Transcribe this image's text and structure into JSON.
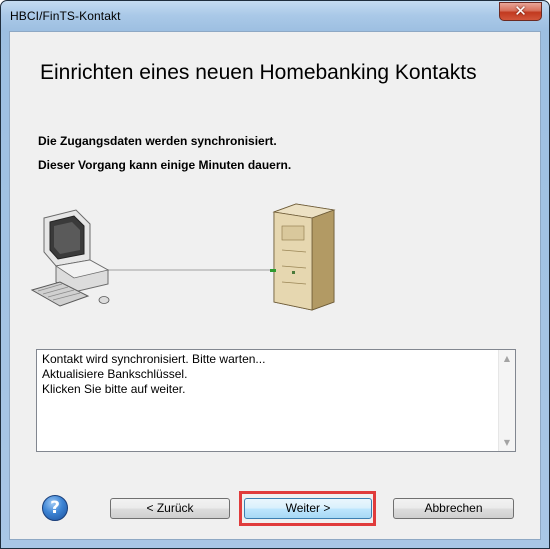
{
  "window": {
    "title": "HBCI/FinTS-Kontakt",
    "close_glyph": "✕",
    "close_icon": "close-icon"
  },
  "wizard": {
    "heading": "Einrichten eines neuen Homebanking Kontakts",
    "info_line_1": "Die Zugangsdaten werden synchronisiert.",
    "info_line_2": "Dieser Vorgang kann einige Minuten dauern."
  },
  "illustration": {
    "left_icon": "computer-icon",
    "right_icon": "server-icon"
  },
  "log": {
    "lines": [
      "Kontakt wird synchronisiert. Bitte warten...",
      "Aktualisiere Bankschlüssel.",
      "Klicken Sie bitte auf weiter."
    ]
  },
  "buttons": {
    "help_glyph": "?",
    "back": "< Zurück",
    "next": "Weiter >",
    "cancel": "Abbrechen"
  },
  "colors": {
    "highlight": "#e03c3c",
    "dialog_bg": "#f0f0f0",
    "frame": "#a9c7e6"
  }
}
